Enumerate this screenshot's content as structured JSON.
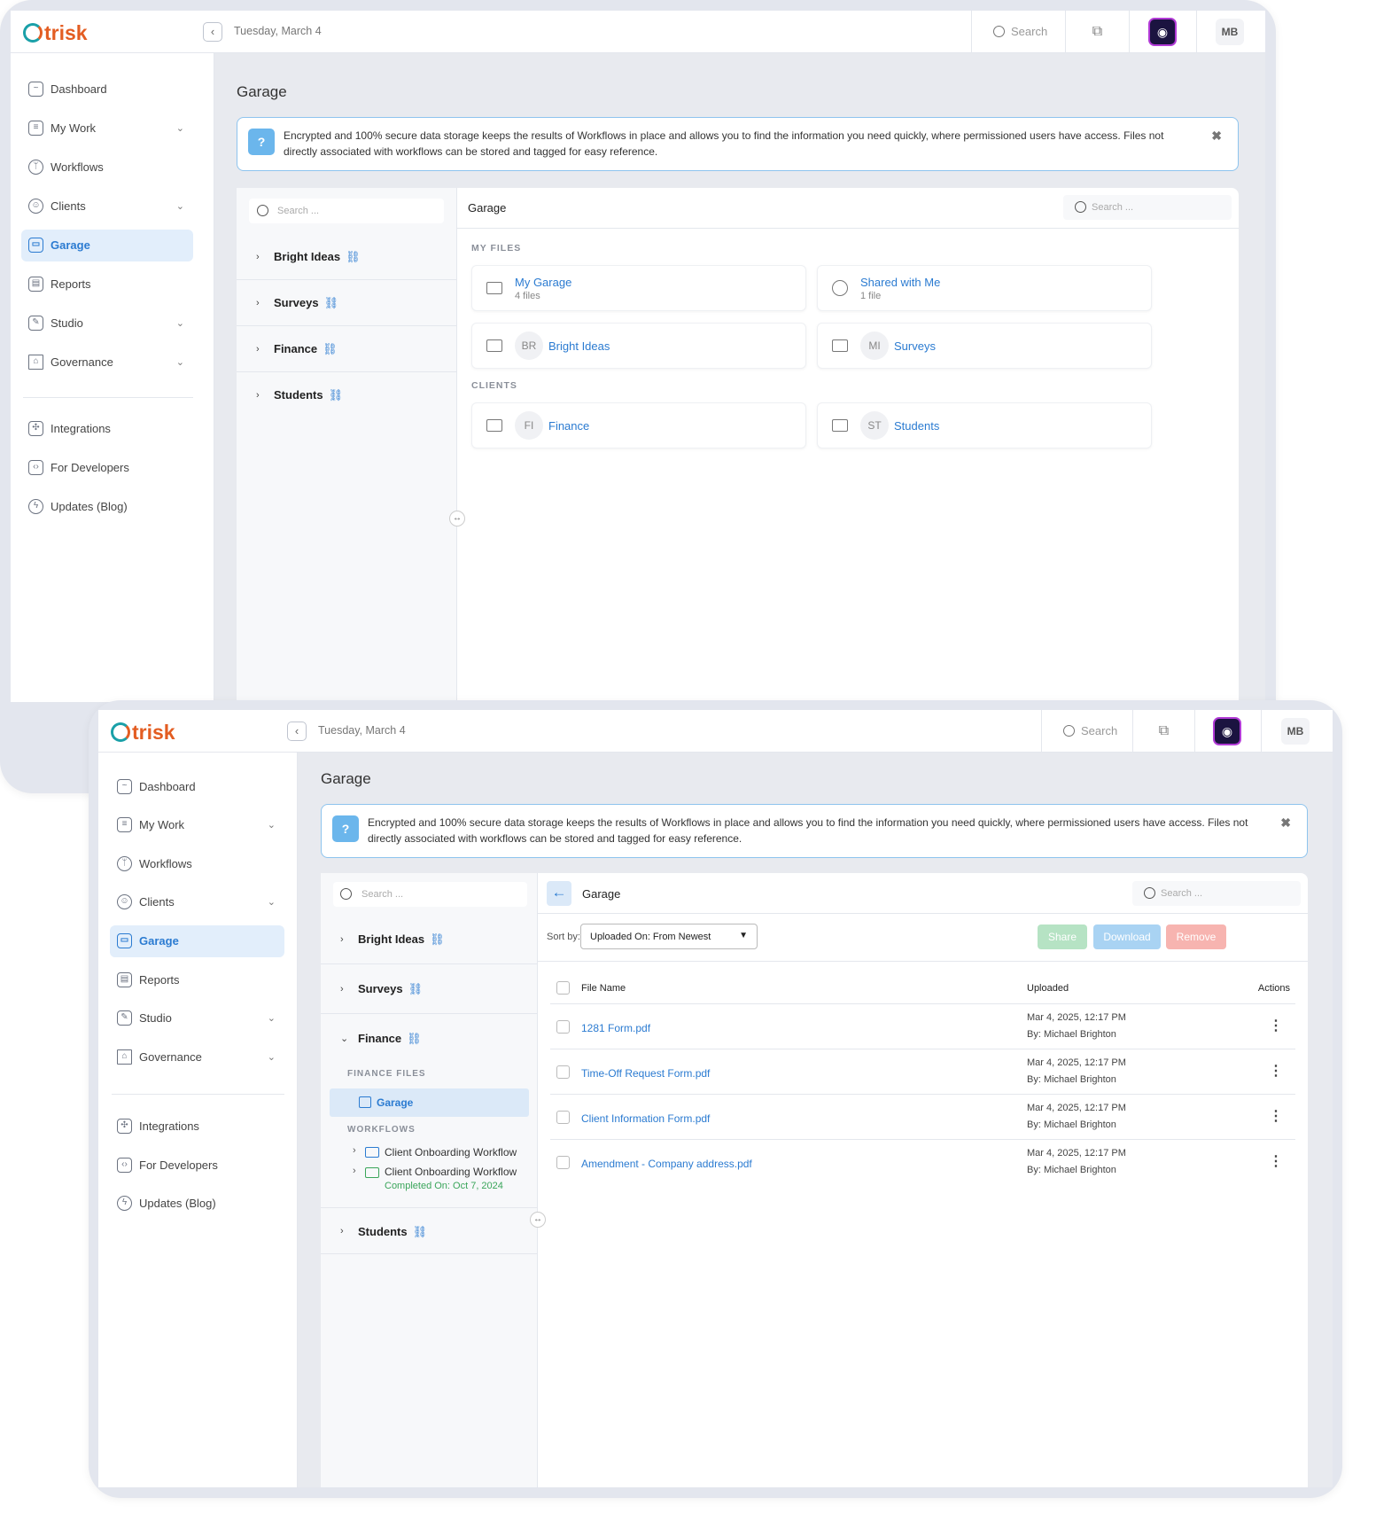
{
  "app": {
    "logo_text": "trisk",
    "date": "Tuesday, March 4",
    "search_label": "Search",
    "avatar": "MB",
    "brand_color": "#e35d22"
  },
  "sidebar": {
    "items": [
      {
        "label": "Dashboard",
        "icon": "dashboard-icon"
      },
      {
        "label": "My Work",
        "icon": "checklist-icon",
        "expandable": true
      },
      {
        "label": "Workflows",
        "icon": "workflow-icon"
      },
      {
        "label": "Clients",
        "icon": "users-icon",
        "expandable": true
      },
      {
        "label": "Garage",
        "icon": "archive-icon",
        "active": true
      },
      {
        "label": "Reports",
        "icon": "report-icon"
      },
      {
        "label": "Studio",
        "icon": "pencil-icon",
        "expandable": true
      },
      {
        "label": "Governance",
        "icon": "bank-icon",
        "expandable": true
      }
    ],
    "secondary": [
      {
        "label": "Integrations",
        "icon": "puzzle-icon"
      },
      {
        "label": "For Developers",
        "icon": "code-icon"
      },
      {
        "label": "Updates (Blog)",
        "icon": "lightning-icon"
      }
    ]
  },
  "page": {
    "title": "Garage",
    "banner": "Encrypted and 100% secure data storage keeps the results of Workflows in place and allows you to find the information you need quickly, where permissioned users have access. Files not directly associated with workflows can be stored and tagged for easy reference.",
    "left_search_placeholder": "Search ...",
    "right_search_placeholder": "Search ...",
    "tree": [
      "Bright Ideas",
      "Surveys",
      "Finance",
      "Students"
    ]
  },
  "screen1": {
    "header": "Garage",
    "my_files_label": "MY FILES",
    "clients_label": "CLIENTS",
    "my_garage": {
      "name": "My Garage",
      "count": "4 files"
    },
    "shared": {
      "name": "Shared with Me",
      "count": "1 file"
    },
    "folders": [
      {
        "initials": "BR",
        "name": "Bright Ideas"
      },
      {
        "initials": "MI",
        "name": "Surveys"
      },
      {
        "initials": "FI",
        "name": "Finance"
      },
      {
        "initials": "ST",
        "name": "Students"
      }
    ]
  },
  "screen2": {
    "header": "Garage",
    "finance_files_label": "FINANCE FILES",
    "finance_garage": "Garage",
    "workflows_label": "WORKFLOWS",
    "workflows": [
      {
        "name": "Client Onboarding Workflow",
        "status": ""
      },
      {
        "name": "Client Onboarding Workflow",
        "status": "Completed On: Oct 7, 2024"
      }
    ],
    "sort_label": "Sort by:",
    "sort_value": "Uploaded On: From Newest",
    "buttons": {
      "share": "Share",
      "download": "Download",
      "remove": "Remove"
    },
    "columns": {
      "file_name": "File Name",
      "uploaded": "Uploaded",
      "actions": "Actions"
    },
    "files": [
      {
        "name": "1281 Form.pdf",
        "date": "Mar 4, 2025, 12:17 PM",
        "by": "By: Michael Brighton"
      },
      {
        "name": "Time-Off Request Form.pdf",
        "date": "Mar 4, 2025, 12:17 PM",
        "by": "By: Michael Brighton"
      },
      {
        "name": "Client Information Form.pdf",
        "date": "Mar 4, 2025, 12:17 PM",
        "by": "By: Michael Brighton"
      },
      {
        "name": "Amendment - Company address.pdf",
        "date": "Mar 4, 2025, 12:17 PM",
        "by": "By: Michael Brighton"
      }
    ]
  }
}
